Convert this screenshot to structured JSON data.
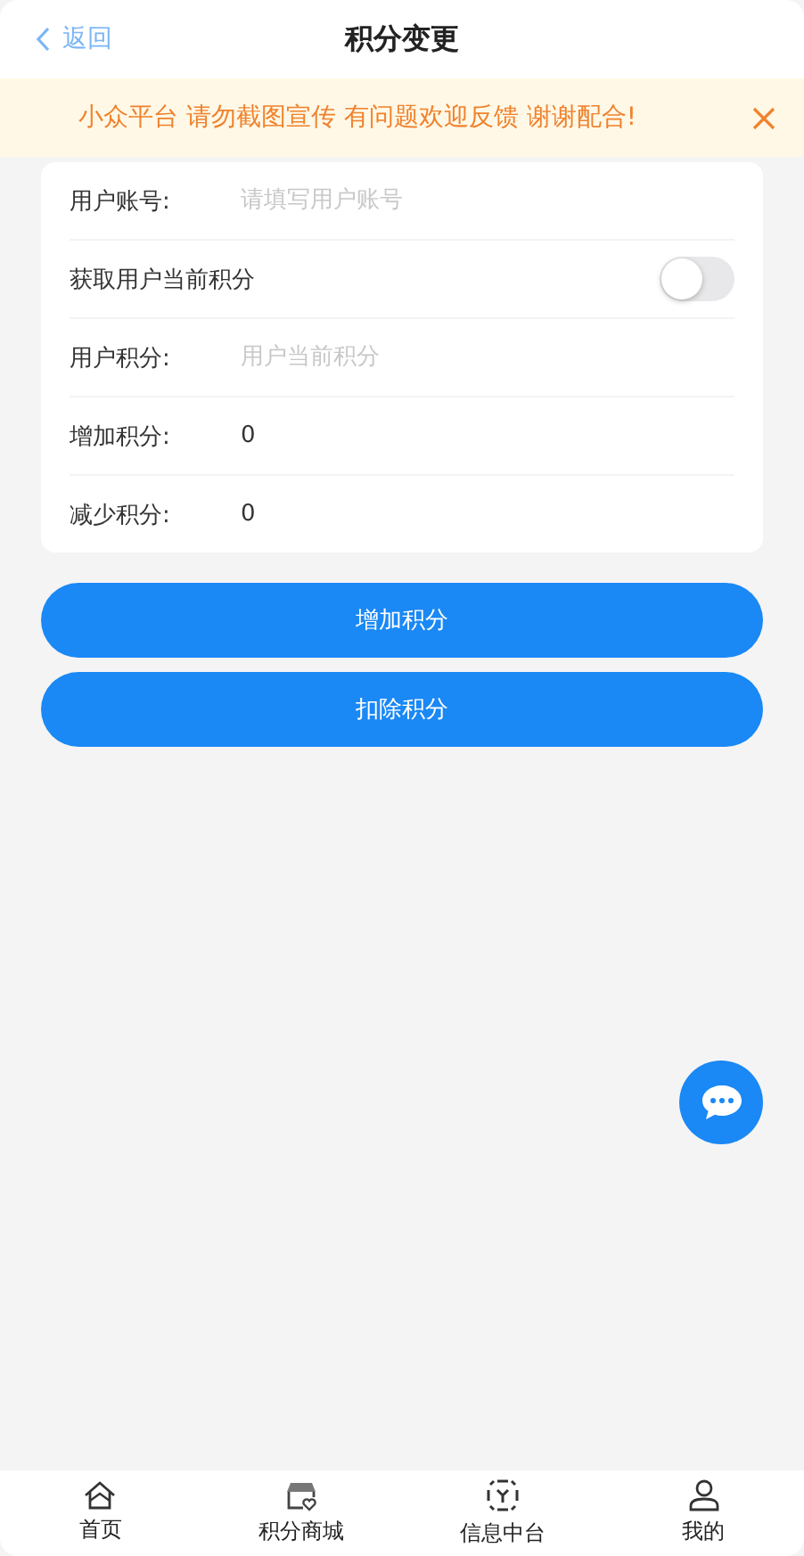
{
  "header": {
    "back": "返回",
    "title": "积分变更"
  },
  "notice": {
    "text": "小众平台 请勿截图宣传 有问题欢迎反馈 谢谢配合!"
  },
  "form": [
    {
      "kind": "input",
      "label": "用户账号:",
      "placeholder": "请填写用户账号"
    },
    {
      "kind": "toggle",
      "label": "获取用户当前积分",
      "on": false
    },
    {
      "kind": "input",
      "label": "用户积分:",
      "placeholder": "用户当前积分"
    },
    {
      "kind": "value",
      "label": "增加积分:",
      "value": "0"
    },
    {
      "kind": "value",
      "label": "减少积分:",
      "value": "0"
    }
  ],
  "buttons": [
    "增加积分",
    "扣除积分"
  ],
  "tabbar": [
    {
      "label": "首页",
      "kind": "home"
    },
    {
      "label": "积分商城",
      "kind": "shop"
    },
    {
      "label": "信息中台",
      "kind": "hub"
    },
    {
      "label": "我的",
      "kind": "user"
    }
  ]
}
